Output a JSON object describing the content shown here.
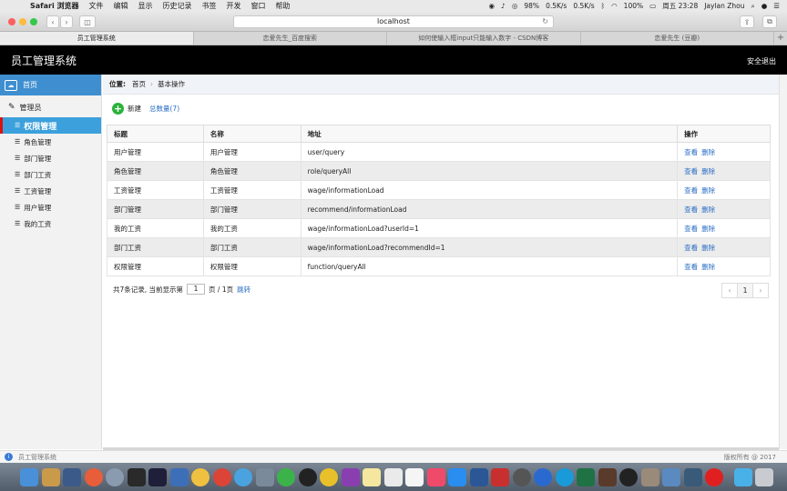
{
  "menubar": {
    "app": "Safari 浏览器",
    "items": [
      "文件",
      "编辑",
      "显示",
      "历史记录",
      "书签",
      "开发",
      "窗口",
      "帮助"
    ],
    "battery_text": "98%",
    "wifi_battery": "100%",
    "net_up": "0.5K/s",
    "net_down": "0.5K/s",
    "clock": "周五 23:28",
    "user": "Jaylan Zhou"
  },
  "browser": {
    "address": "localhost",
    "tabs": [
      "员工管理系统",
      "恋爱先生_百度搜索",
      "如何使输入框input只能输入数字 - CSDN博客",
      "恋爱先生 (豆瓣)"
    ]
  },
  "header": {
    "title": "员工管理系统",
    "logout": "安全退出"
  },
  "sidebar": {
    "home": "首页",
    "group": "管理员",
    "items": [
      "权限管理",
      "角色管理",
      "部门管理",
      "部门工资",
      "工资管理",
      "用户管理",
      "我的工资"
    ],
    "active_index": 0
  },
  "breadcrumb": {
    "label": "位置:",
    "home": "首页",
    "current": "基本操作"
  },
  "toolbar": {
    "new_label": "新建",
    "total_label": "总数量(7)"
  },
  "table": {
    "headers": [
      "标题",
      "名称",
      "地址",
      "操作"
    ],
    "rows": [
      [
        "用户管理",
        "用户管理",
        "user/query"
      ],
      [
        "角色管理",
        "角色管理",
        "role/queryAll"
      ],
      [
        "工资管理",
        "工资管理",
        "wage/informationLoad"
      ],
      [
        "部门管理",
        "部门管理",
        "recommend/informationLoad"
      ],
      [
        "我的工资",
        "我的工资",
        "wage/informationLoad?userId=1"
      ],
      [
        "部门工资",
        "部门工资",
        "wage/informationLoad?recommendId=1"
      ],
      [
        "权限管理",
        "权限管理",
        "function/queryAll"
      ]
    ],
    "view_label": "查看",
    "delete_label": "删除"
  },
  "pagination": {
    "summary_prefix": "共7条记录,  当前显示第",
    "page_value": "1",
    "summary_suffix": "页 / 1页",
    "jump_label": "跳转",
    "current_page": "1",
    "prev": "‹",
    "next": "›"
  },
  "statusbar": {
    "left": "员工管理系统",
    "right": "版权所有 @ 2017"
  },
  "colors": {
    "header_bg": "#000000",
    "sidebar_active": "#3ca0dc",
    "link": "#2a6dc4",
    "add_green": "#2bb23b"
  }
}
